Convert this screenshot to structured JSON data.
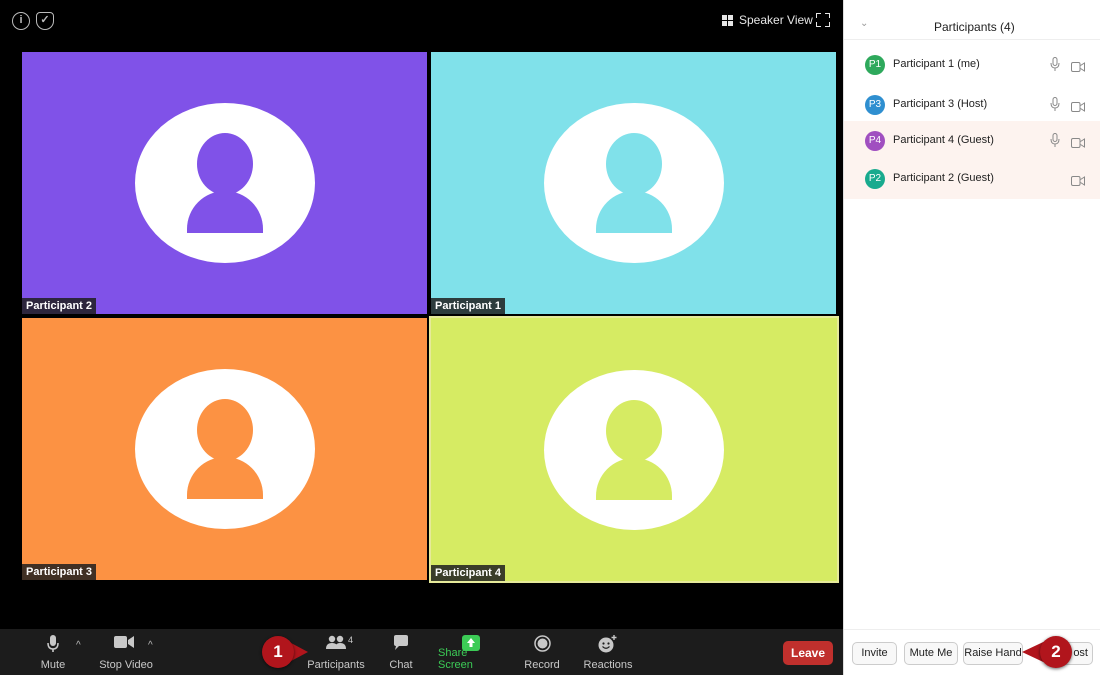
{
  "meeting": {
    "speaker_view_label": "Speaker View",
    "tiles": [
      {
        "label": "Participant 2",
        "color": "#8052e8"
      },
      {
        "label": "Participant 1",
        "color": "#80e1ea"
      },
      {
        "label": "Participant 3",
        "color": "#fc9243"
      },
      {
        "label": "Participant 4",
        "color": "#d6eb63"
      }
    ]
  },
  "toolbar": {
    "mute": "Mute",
    "stop_video": "Stop Video",
    "participants": "Participants",
    "participants_count": "4",
    "chat": "Chat",
    "share_screen": "Share Screen",
    "record": "Record",
    "reactions": "Reactions",
    "leave": "Leave"
  },
  "panel": {
    "title": "Participants (4)",
    "participants": [
      {
        "badge": "P1",
        "name": "Participant 1 (me)",
        "color": "#2ea95c",
        "mic": true,
        "cam": true,
        "highlight": false
      },
      {
        "badge": "P3",
        "name": "Participant 3 (Host)",
        "color": "#2f8fd0",
        "mic": true,
        "cam": true,
        "highlight": false
      },
      {
        "badge": "P4",
        "name": "Participant 4 (Guest)",
        "color": "#a04fc0",
        "mic": true,
        "cam": true,
        "highlight": true
      },
      {
        "badge": "P2",
        "name": "Participant 2 (Guest)",
        "color": "#18aa8e",
        "mic": false,
        "cam": true,
        "highlight": true
      }
    ],
    "buttons": {
      "invite": "Invite",
      "mute_me": "Mute Me",
      "raise_hand": "Raise Hand",
      "partial": "ost"
    }
  },
  "callouts": {
    "one": "1",
    "two": "2"
  },
  "colors": {
    "share_green": "#3ccb56",
    "leave_red": "#c0302d",
    "callout_red": "#b1151c"
  }
}
